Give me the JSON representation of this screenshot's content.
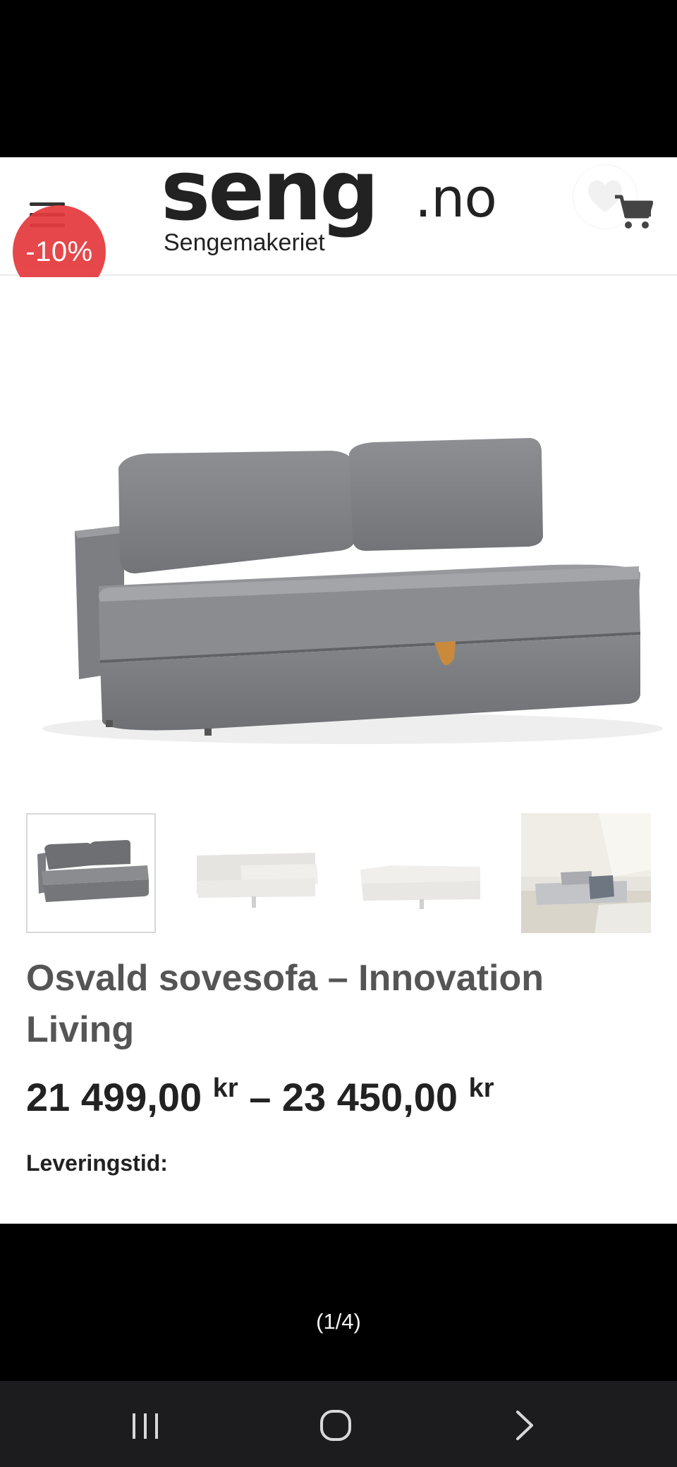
{
  "header": {
    "menu_icon": "hamburger-menu-icon",
    "discount_badge": "-10%",
    "logo_main": "seng",
    "logo_tld": ".no",
    "logo_subtitle": "Sengemakeriet",
    "wishlist_icon": "heart-icon",
    "cart_icon": "shopping-cart-icon"
  },
  "gallery": {
    "main_image": "grey-sofa-bed-image",
    "thumbnails": [
      {
        "name": "grey-sofa-thumbnail",
        "active": true
      },
      {
        "name": "beige-sofa-bed-open-thumbnail",
        "active": false
      },
      {
        "name": "beige-bed-flat-thumbnail",
        "active": false
      },
      {
        "name": "living-room-sofa-thumbnail",
        "active": false
      }
    ],
    "counter": "(1/4)"
  },
  "product": {
    "title": "Osvald sovesofa – Innovation Living",
    "price_from": "21 499,00",
    "price_to": "23 450,00",
    "currency": "kr",
    "price_separator": "–",
    "delivery_label": "Leveringstid:"
  },
  "colors": {
    "badge": "#e53a3d",
    "sofa": "#8a8c90",
    "nav_bar": "#1c1c1e"
  },
  "system_nav": {
    "recent": "recent-apps-icon",
    "home": "home-icon",
    "back": "back-icon"
  }
}
